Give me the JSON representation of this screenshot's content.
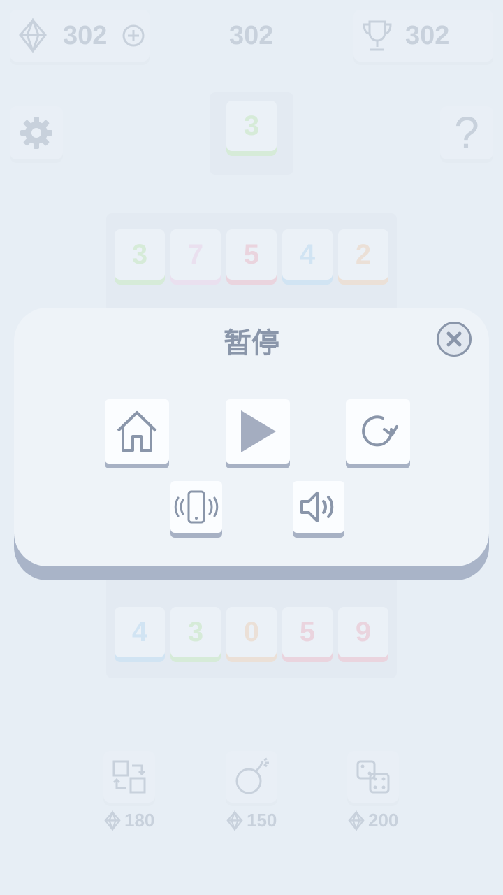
{
  "top_bar": {
    "gems": "302",
    "score": "302",
    "best": "302"
  },
  "next_tile": {
    "value": "3",
    "color": "#b7e6a4"
  },
  "grid": {
    "rows": [
      [
        {
          "v": "3",
          "c": "#b7e6a4"
        },
        {
          "v": "7",
          "c": "#f0c7e6"
        },
        {
          "v": "5",
          "c": "#f1a5b6"
        },
        {
          "v": "4",
          "c": "#a9d3f2"
        },
        {
          "v": "2",
          "c": "#f5c9a0"
        }
      ],
      [
        {
          "v": "4",
          "c": "#a9d3f2"
        },
        {
          "v": "3",
          "c": "#b7e6a4"
        },
        {
          "v": "0",
          "c": "#f5c9a0"
        },
        {
          "v": "5",
          "c": "#f1a5b6"
        },
        {
          "v": "9",
          "c": "#f1a5b6"
        }
      ]
    ]
  },
  "tools": [
    {
      "name": "swap",
      "cost": "180"
    },
    {
      "name": "bomb",
      "cost": "150"
    },
    {
      "name": "dice",
      "cost": "200"
    }
  ],
  "pause_dialog": {
    "title": "暂停",
    "buttons": [
      "home",
      "play",
      "restart",
      "vibration",
      "sound"
    ]
  },
  "colors": {
    "background": "#e7eef5",
    "icon": "#8a96aa",
    "button_shadow": "#a7b1c4"
  }
}
